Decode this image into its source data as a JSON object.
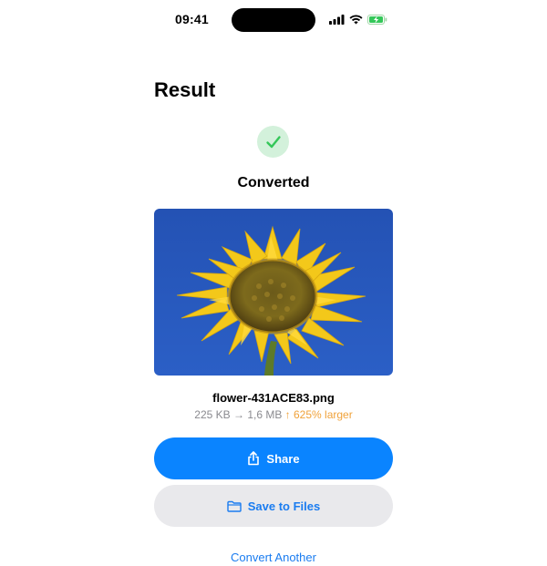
{
  "status_bar": {
    "time": "09:41",
    "icons": [
      "signal-icon",
      "wifi-icon",
      "battery-charging-icon"
    ]
  },
  "page": {
    "title": "Result",
    "state_label": "Converted"
  },
  "result": {
    "filename": "flower-431ACE83.png",
    "size_info": "225 KB → 1,6 MB",
    "size_delta": "↑ 625% larger",
    "image_description_icon": "sunflower-photo"
  },
  "actions": {
    "share_label": "Share",
    "save_label": "Save to Files",
    "convert_another_label": "Convert Another"
  },
  "colors": {
    "accent": "#0a84ff",
    "success_bg": "#d3f1db",
    "success_check": "#34c759",
    "warning": "#f0a23a",
    "secondary_button_bg": "#e9e9ec"
  }
}
